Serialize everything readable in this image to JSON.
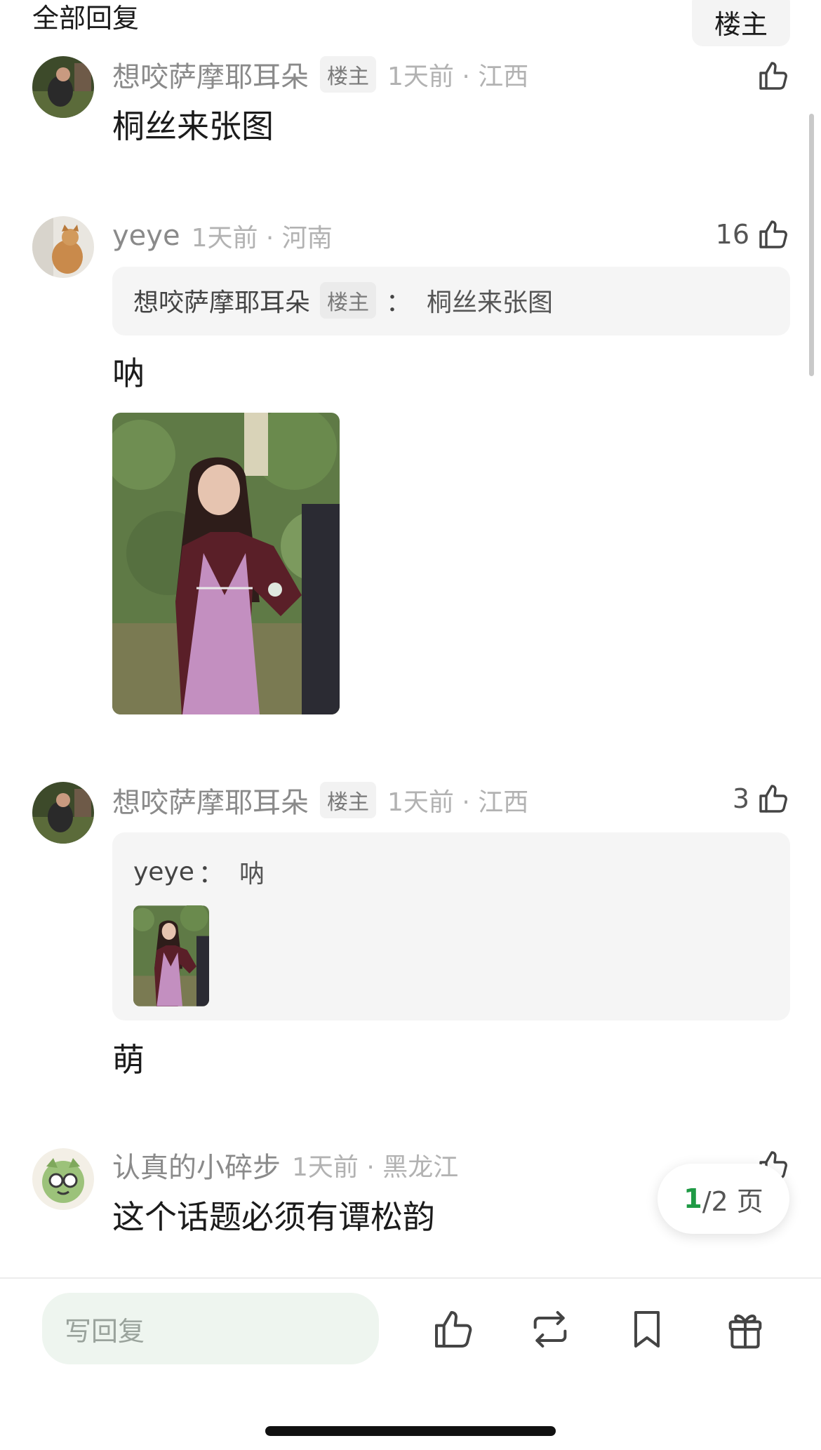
{
  "header": {
    "title": "全部回复",
    "filter_label": "楼主"
  },
  "comments": [
    {
      "username": "想咬萨摩耶耳朵",
      "badge": "楼主",
      "meta": "1天前 · 江西",
      "text": "桐丝来张图"
    },
    {
      "username": "yeye",
      "meta": "1天前 · 河南",
      "likes": "16",
      "quote": {
        "username": "想咬萨摩耶耳朵",
        "badge": "楼主",
        "sep": "：",
        "text": "桐丝来张图"
      },
      "text": "呐"
    },
    {
      "username": "想咬萨摩耶耳朵",
      "badge": "楼主",
      "meta": "1天前 · 江西",
      "likes": "3",
      "quote": {
        "username": "yeye",
        "sep": "：",
        "text": "呐"
      },
      "text": "萌"
    },
    {
      "username": "认真的小碎步",
      "meta": "1天前 · 黑龙江",
      "text": "这个话题必须有谭松韵"
    }
  ],
  "pager": {
    "current": "1",
    "rest": "/2 页"
  },
  "bottom_bar": {
    "reply_placeholder": "写回复",
    "icons": [
      "like-icon",
      "repost-icon",
      "bookmark-icon",
      "gift-icon"
    ]
  },
  "colors": {
    "accent_green": "#1f9a45",
    "reply_bg": "#eef5ef",
    "quote_bg": "#f5f5f5"
  }
}
